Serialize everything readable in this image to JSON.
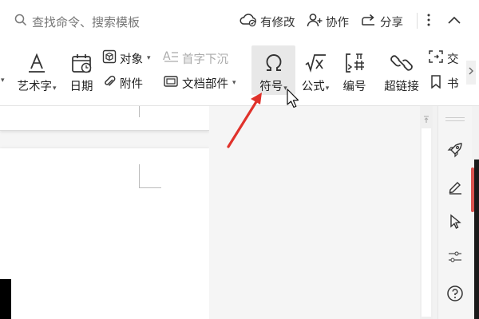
{
  "search": {
    "placeholder": "查找命令、搜索模板"
  },
  "topbar": {
    "modified_label": "有修改",
    "collab_label": "协作",
    "share_label": "分享"
  },
  "ribbon": {
    "art_text_label": "艺术字",
    "date_label": "日期",
    "object_label": "对象",
    "attachment_label": "附件",
    "drop_cap_label": "首字下沉",
    "doc_parts_label": "文档部件",
    "symbol_label": "符号",
    "formula_label": "公式",
    "numbering_label": "编号",
    "hyperlink_label": "超链接",
    "cross_ref_label": "交",
    "bookmark_label": "书"
  },
  "colors": {
    "accent_red": "#e0322b"
  }
}
